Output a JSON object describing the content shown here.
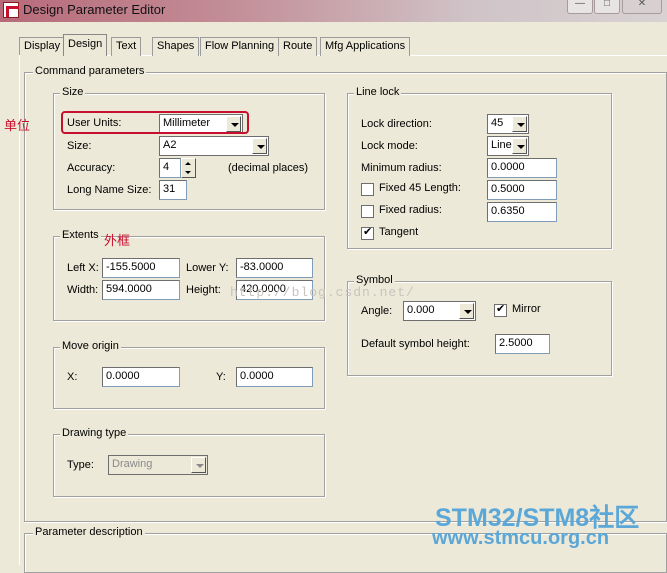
{
  "window": {
    "title": "Design Parameter Editor"
  },
  "tabs": [
    {
      "label": "Display"
    },
    {
      "label": "Design"
    },
    {
      "label": "Text"
    },
    {
      "label": "Shapes"
    },
    {
      "label": "Flow Planning"
    },
    {
      "label": "Route"
    },
    {
      "label": "Mfg Applications"
    }
  ],
  "active_tab": "Design",
  "command_group": {
    "title": "Command parameters"
  },
  "size_group": {
    "title": "Size",
    "user_units_label": "User Units:",
    "user_units_value": "Millimeter",
    "size_label": "Size:",
    "size_value": "A2",
    "accuracy_label": "Accuracy:",
    "accuracy_value": "4",
    "accuracy_suffix": "(decimal places)",
    "long_name_label": "Long Name Size:",
    "long_name_value": "31"
  },
  "extents_group": {
    "title": "Extents",
    "left_x_label": "Left X:",
    "left_x_value": "-155.5000",
    "lower_y_label": "Lower Y:",
    "lower_y_value": "-83.0000",
    "width_label": "Width:",
    "width_value": "594.0000",
    "height_label": "Height:",
    "height_value": "420.0000"
  },
  "move_origin_group": {
    "title": "Move origin",
    "x_label": "X:",
    "x_value": "0.0000",
    "y_label": "Y:",
    "y_value": "0.0000"
  },
  "drawing_type_group": {
    "title": "Drawing type",
    "type_label": "Type:",
    "type_value": "Drawing"
  },
  "line_lock_group": {
    "title": "Line lock",
    "lock_direction_label": "Lock direction:",
    "lock_direction_value": "45",
    "lock_mode_label": "Lock mode:",
    "lock_mode_value": "Line",
    "min_radius_label": "Minimum radius:",
    "min_radius_value": "0.0000",
    "fixed45_label": "Fixed 45 Length:",
    "fixed45_value": "0.5000",
    "fixed45_checked": false,
    "fixed_radius_label": "Fixed radius:",
    "fixed_radius_value": "0.6350",
    "fixed_radius_checked": false,
    "tangent_label": "Tangent",
    "tangent_checked": true
  },
  "symbol_group": {
    "title": "Symbol",
    "angle_label": "Angle:",
    "angle_value": "0.000",
    "mirror_label": "Mirror",
    "mirror_checked": true,
    "default_height_label": "Default symbol height:",
    "default_height_value": "2.5000"
  },
  "parameter_description": {
    "title": "Parameter description"
  },
  "annotations": {
    "units_note": "单位",
    "extents_note": "外框",
    "highlight_color": "#c8102e"
  },
  "watermarks": {
    "url": "http://blog.csdn.net/",
    "brand_line1": "STM32/STM8社区",
    "brand_line2": "www.stmcu.org.cn"
  }
}
